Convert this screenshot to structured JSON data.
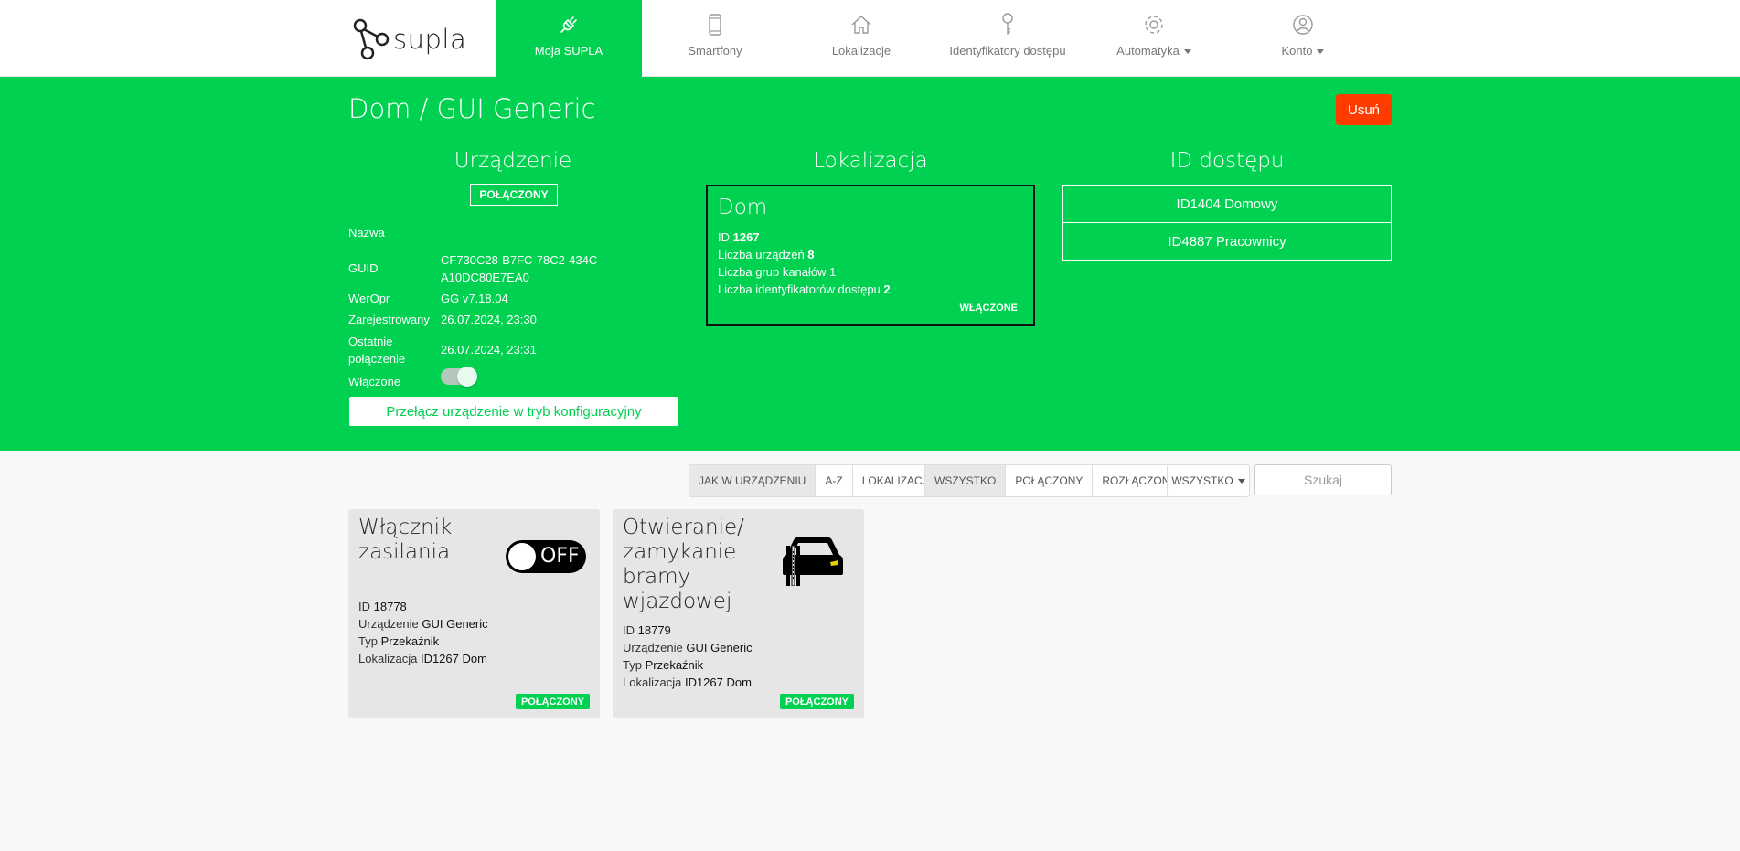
{
  "nav": {
    "logo": "supla",
    "items": [
      {
        "label": "Moja SUPLA",
        "icon": "plug-icon",
        "active": true
      },
      {
        "label": "Smartfony",
        "icon": "smartphone-icon"
      },
      {
        "label": "Lokalizacje",
        "icon": "home-icon"
      },
      {
        "label": "Identyfikatory dostępu",
        "icon": "key-icon"
      },
      {
        "label": "Automatyka",
        "icon": "gear-icon",
        "dropdown": true
      },
      {
        "label": "Konto",
        "icon": "user-icon",
        "dropdown": true
      }
    ]
  },
  "header": {
    "title": "Dom / GUI Generic",
    "delete_label": "Usuń"
  },
  "device": {
    "heading": "Urządzenie",
    "status": "POŁĄCZONY",
    "fields": [
      {
        "label": "Nazwa",
        "value": ""
      },
      {
        "label": "GUID",
        "value": "CF730C28-B7FC-78C2-434C-",
        "value2": "A10DC80E7EA0"
      },
      {
        "label": "WerOpr",
        "value": "GG v7.18.04"
      },
      {
        "label": "Zarejestrowany",
        "value": "26.07.2024, 23:30"
      },
      {
        "label": "Ostatnie",
        "label2": "połączenie",
        "value": "26.07.2024, 23:31"
      },
      {
        "label": "Włączone",
        "value": ""
      }
    ],
    "enabled": true,
    "config_button": "Przełącz urządzenie w tryb konfiguracyjny"
  },
  "location": {
    "heading": "Lokalizacja",
    "name": "Dom",
    "id_label": "ID",
    "id": "1267",
    "devices_label": "Liczba urządzeń",
    "devices": "8",
    "groups_label": "Liczba grup kanałów",
    "groups": "1",
    "access_label": "Liczba identyfikatorów dostępu",
    "access": "2",
    "status": "WŁĄCZONE"
  },
  "access_ids": {
    "heading": "ID dostępu",
    "items": [
      "ID1404 Domowy",
      "ID4887 Pracownicy"
    ]
  },
  "filters": {
    "sort": [
      "JAK W URZĄDZENIU",
      "A-Z",
      "LOKALIZACJA"
    ],
    "connection": [
      "WSZYSTKO",
      "POŁĄCZONY",
      "ROZŁĄCZONY"
    ],
    "dropdown": "WSZYSTKO",
    "search_placeholder": "Szukaj"
  },
  "channels": [
    {
      "title_lines": [
        "Włącznik",
        "zasilania"
      ],
      "icon": "power-switch-off-icon",
      "state_text": "OFF",
      "id_label": "ID",
      "id": "18778",
      "device_label": "Urządzenie",
      "device": "GUI Generic",
      "type_label": "Typ",
      "type": "Przekaźnik",
      "location_label": "Lokalizacja",
      "location": "ID1267 Dom",
      "status": "POŁĄCZONY"
    },
    {
      "title_lines": [
        "Otwieranie/",
        "zamykanie",
        "bramy",
        "wjazdowej"
      ],
      "icon": "gate-car-icon",
      "id_label": "ID",
      "id": "18779",
      "device_label": "Urządzenie",
      "device": "GUI Generic",
      "type_label": "Typ",
      "type": "Przekaźnik",
      "location_label": "Lokalizacja",
      "location": "ID1267 Dom",
      "status": "POŁĄCZONY"
    }
  ],
  "colors": {
    "brand": "#00d151",
    "danger": "#ff3c00"
  }
}
